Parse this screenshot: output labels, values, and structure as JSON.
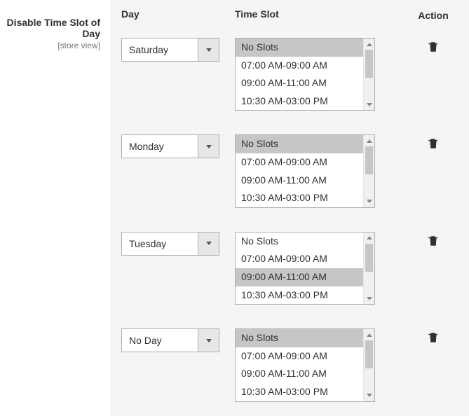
{
  "label": {
    "title": "Disable Time Slot of Day",
    "scope": "[store view]"
  },
  "headers": {
    "day": "Day",
    "slot": "Time Slot",
    "action": "Action"
  },
  "rows": [
    {
      "day": "Saturday",
      "options": [
        {
          "label": "No Slots",
          "selected": true
        },
        {
          "label": "07:00 AM-09:00 AM",
          "selected": false
        },
        {
          "label": "09:00 AM-11:00 AM",
          "selected": false
        },
        {
          "label": "10:30 AM-03:00 PM",
          "selected": false
        }
      ]
    },
    {
      "day": "Monday",
      "options": [
        {
          "label": "No Slots",
          "selected": true
        },
        {
          "label": "07:00 AM-09:00 AM",
          "selected": false
        },
        {
          "label": "09:00 AM-11:00 AM",
          "selected": false
        },
        {
          "label": "10:30 AM-03:00 PM",
          "selected": false
        }
      ]
    },
    {
      "day": "Tuesday",
      "options": [
        {
          "label": "No Slots",
          "selected": false
        },
        {
          "label": "07:00 AM-09:00 AM",
          "selected": false
        },
        {
          "label": "09:00 AM-11:00 AM",
          "selected": true
        },
        {
          "label": "10:30 AM-03:00 PM",
          "selected": false
        }
      ]
    },
    {
      "day": "No Day",
      "options": [
        {
          "label": "No Slots",
          "selected": true
        },
        {
          "label": "07:00 AM-09:00 AM",
          "selected": false
        },
        {
          "label": "09:00 AM-11:00 AM",
          "selected": false
        },
        {
          "label": "10:30 AM-03:00 PM",
          "selected": false
        }
      ]
    }
  ]
}
